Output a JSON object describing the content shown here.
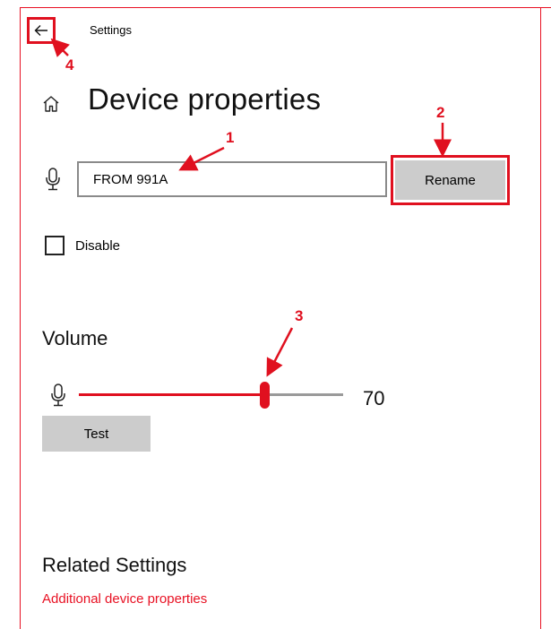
{
  "window": {
    "title": "Settings"
  },
  "page": {
    "title": "Device properties"
  },
  "device": {
    "name_value": "FROM 991A",
    "rename_label": "Rename",
    "disable_label": "Disable",
    "disable_checked": false
  },
  "volume": {
    "section_title": "Volume",
    "value": 70,
    "value_text": "70",
    "test_label": "Test"
  },
  "related": {
    "title": "Related Settings",
    "link_label": "Additional device properties"
  },
  "annotations": {
    "marker_1": "1",
    "marker_2": "2",
    "marker_3": "3",
    "marker_4": "4"
  },
  "colors": {
    "accent": "#e81123",
    "annotation_red": "#e0101f",
    "button_gray": "#cccccc"
  },
  "icons": [
    "back-arrow-icon",
    "home-icon",
    "microphone-icon"
  ]
}
